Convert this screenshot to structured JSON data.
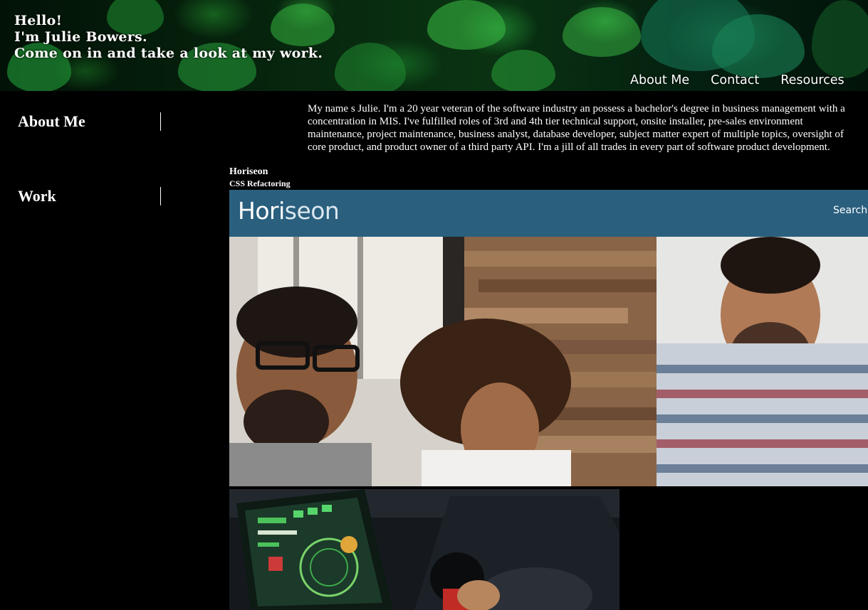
{
  "header": {
    "greeting": "Hello!",
    "name_line": "I'm Julie Bowers.",
    "invite_line": "Come on in and take a look at my work.",
    "nav": [
      "About Me",
      "Contact",
      "Resources"
    ]
  },
  "sidebar": {
    "items": [
      {
        "label": "About Me"
      },
      {
        "label": "Work"
      }
    ]
  },
  "about": {
    "text": "My name s Julie. I'm a 20 year veteran of the software industry an possess a bachelor's degree in business management with a concentration in MIS. I've fulfilled roles of 3rd and 4th tier technical support, onsite installer, pre-sales environment maintenance, project maintenance, business analyst, database developer, subject matter expert of multiple topics, oversight of core product, and product owner of a third party API. I'm a jill of all trades in every part of software product development."
  },
  "work": {
    "projects": [
      {
        "title": "Horiseon",
        "subtitle": "CSS Refactoring",
        "screenshot": {
          "logo_part1": "Hori",
          "logo_part2": "seon",
          "search_label": "Search E"
        }
      }
    ]
  },
  "colors": {
    "page_background": "#000000",
    "horiseon_header": "#2a5f7e",
    "text": "#ffffff"
  }
}
